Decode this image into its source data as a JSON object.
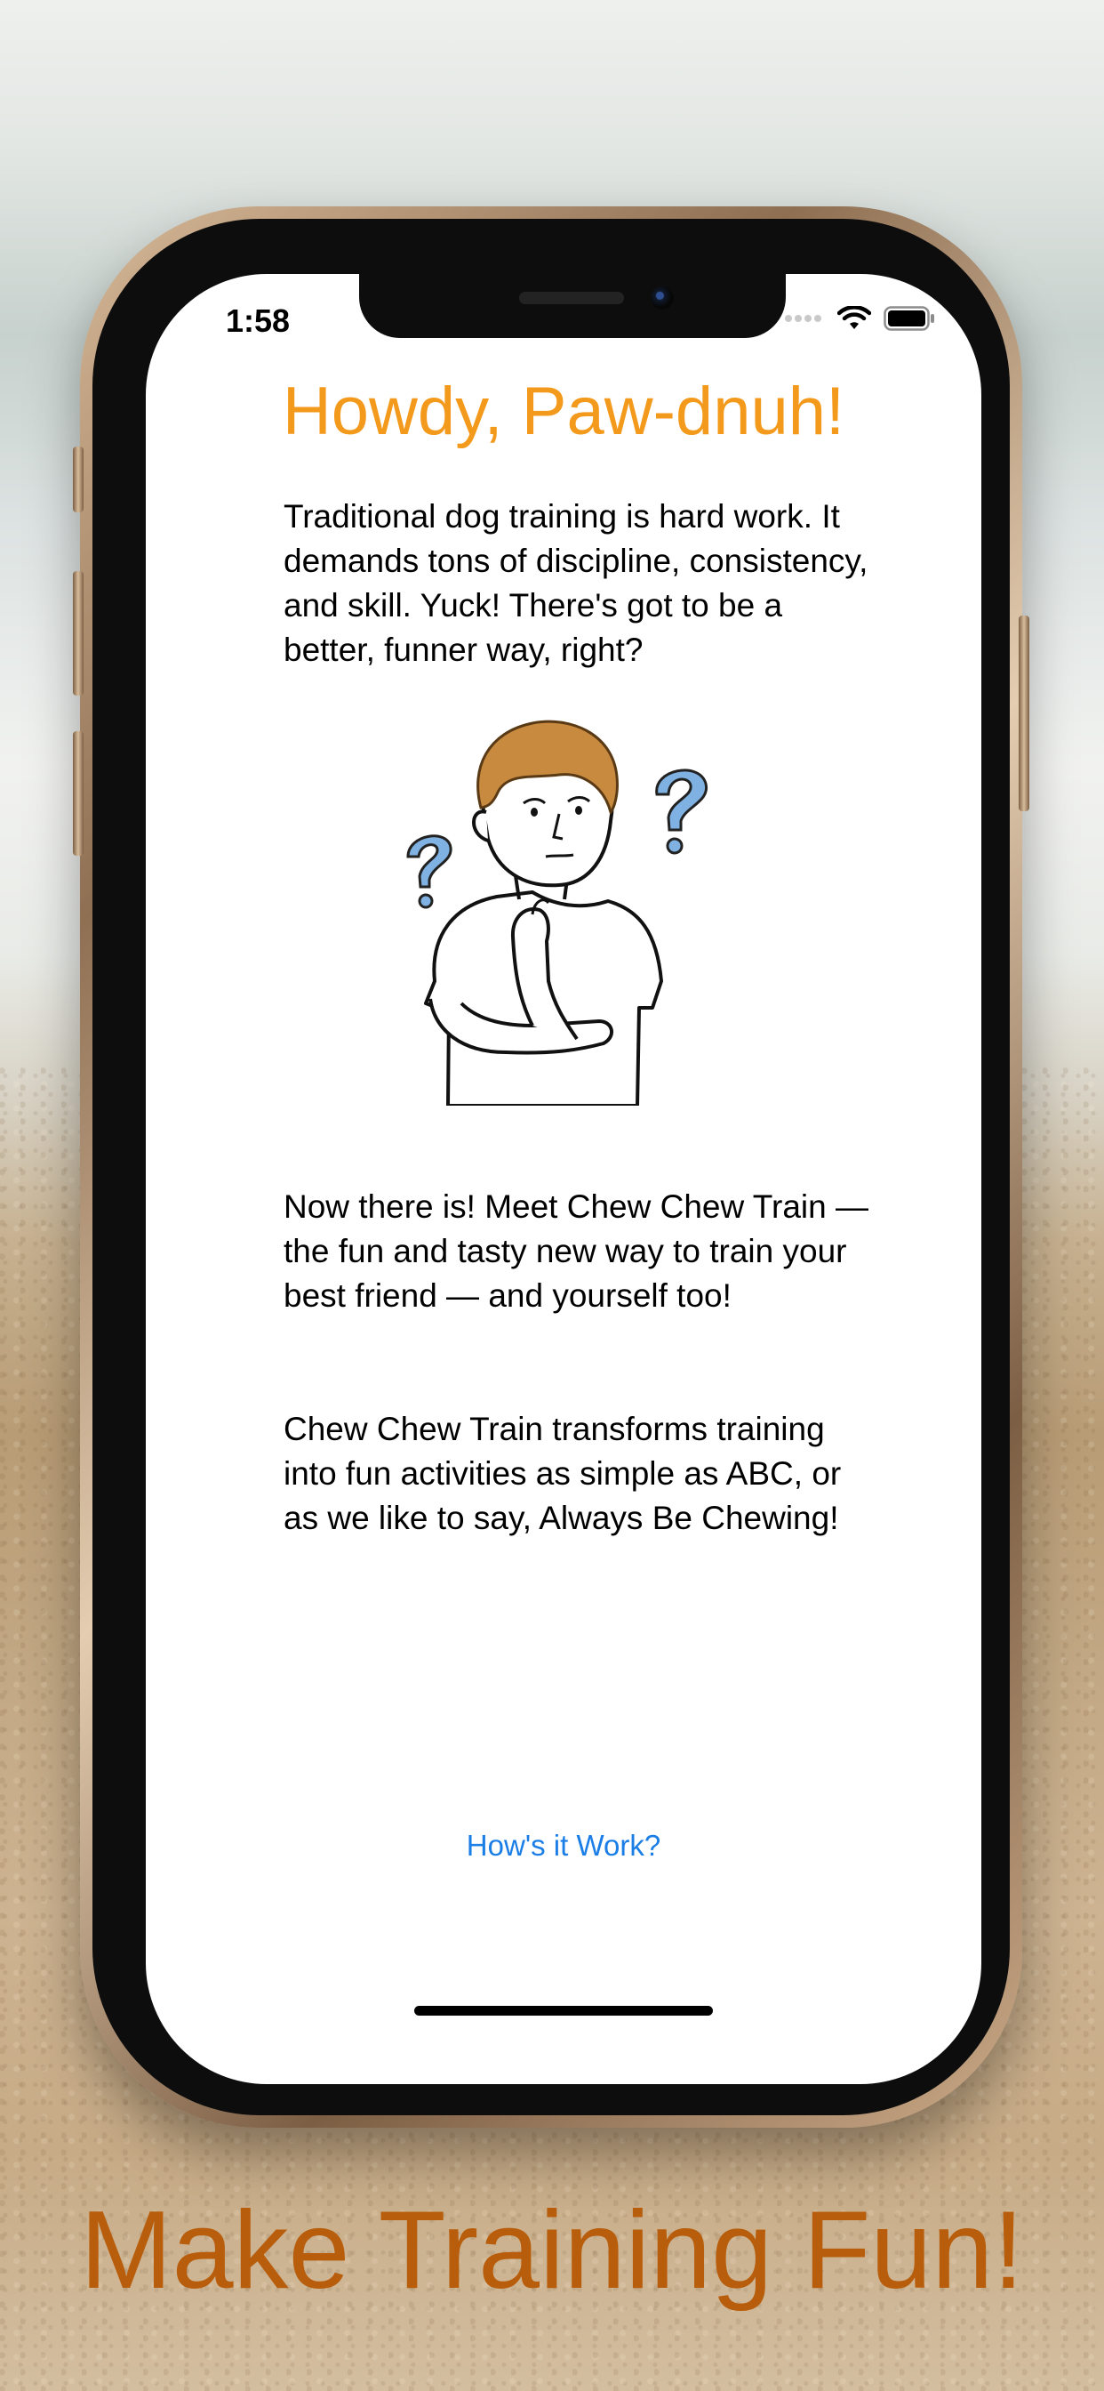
{
  "status_bar": {
    "time": "1:58"
  },
  "screen": {
    "title": "Howdy, Paw-dnuh!",
    "intro": "Traditional dog training is hard work. It demands tons of discipline, consistency, and skill. Yuck! There's got to be a better, funner way, right?",
    "illustration": "thinking-person-illustration",
    "paragraph_2": "Now there is! Meet Chew Chew Train — the fun and tasty new way to train your best friend — and yourself too!",
    "paragraph_3": "Chew Chew Train transforms training into fun activities as simple as ABC, or as we like to say, Always Be Chewing!",
    "how_link": "How's it Work?"
  },
  "tagline": "Make Training Fun!",
  "colors": {
    "title": "#f39a1c",
    "link": "#1a7ee6",
    "tagline": "#b85d0b"
  }
}
